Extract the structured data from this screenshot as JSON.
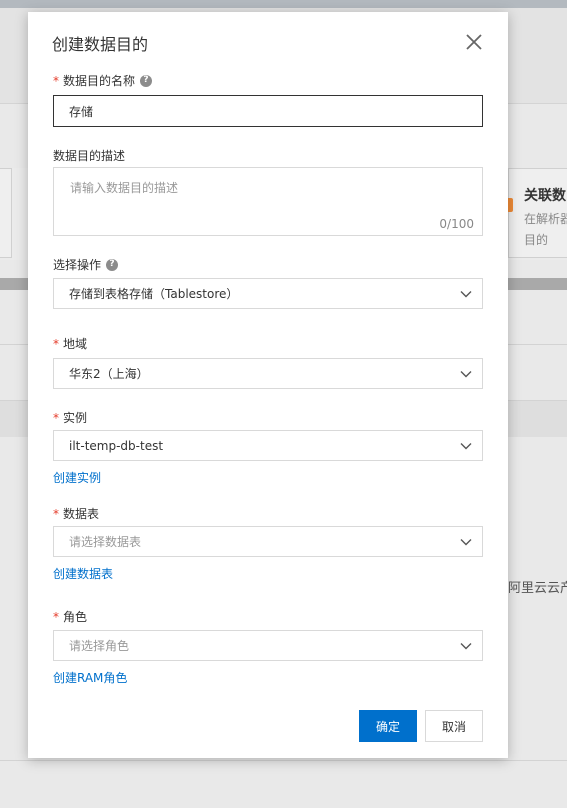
{
  "background": {
    "card_title": "关联数",
    "card_desc_line1": "在解析器",
    "card_desc_line2": "目的",
    "side_text": "阿里云云产品"
  },
  "dialog": {
    "title": "创建数据目的",
    "close_icon": "close-icon",
    "fields": {
      "name": {
        "label": "数据目的名称",
        "required": "*",
        "help_icon": "?",
        "value": "存储"
      },
      "description": {
        "label": "数据目的描述",
        "placeholder": "请输入数据目的描述",
        "counter": "0/100"
      },
      "operation": {
        "label": "选择操作",
        "help_icon": "?",
        "value": "存储到表格存储（Tablestore）"
      },
      "region": {
        "label": "地域",
        "required": "*",
        "value": "华东2（上海）"
      },
      "instance": {
        "label": "实例",
        "required": "*",
        "value": "ilt-temp-db-test",
        "link": "创建实例"
      },
      "table": {
        "label": "数据表",
        "required": "*",
        "placeholder": "请选择数据表",
        "link": "创建数据表"
      },
      "role": {
        "label": "角色",
        "required": "*",
        "placeholder": "请选择角色",
        "link": "创建RAM角色"
      }
    },
    "buttons": {
      "confirm": "确定",
      "cancel": "取消"
    }
  },
  "colors": {
    "primary": "#0070cc",
    "required": "#e43b2a",
    "link": "#0070cc"
  }
}
